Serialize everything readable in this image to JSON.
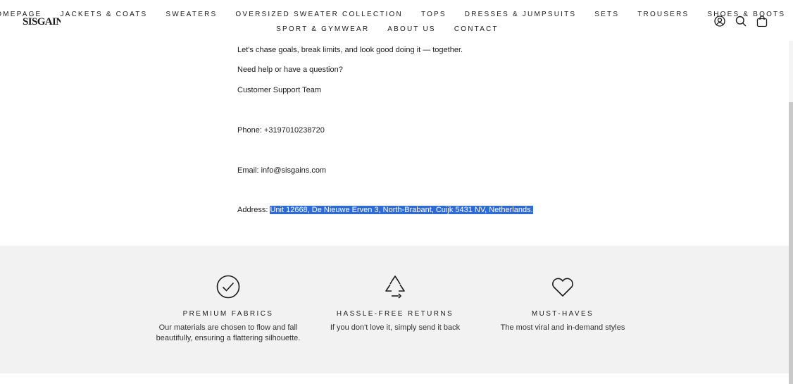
{
  "brand": {
    "logo_text": "SISGAINS"
  },
  "nav": {
    "row1": [
      "Homepage",
      "Jackets & Coats",
      "Sweaters",
      "Oversized Sweater Collection",
      "Tops",
      "Dresses & Jumpsuits",
      "Sets",
      "Trousers",
      "Shoes & Boots"
    ],
    "row2": [
      "Sport & Gymwear",
      "About us",
      "Contact"
    ]
  },
  "header_icons": [
    "account-icon",
    "search-icon",
    "bag-icon"
  ],
  "content": {
    "line1": "Let's chase goals, break limits, and look good doing it — together.",
    "line2": "Need help or have a question?",
    "line3": "Customer Support Team",
    "phone": "Phone: +3197010238720",
    "email": "Email: info@sisgains.com",
    "address_label": "Address: ",
    "address_value": "Unit 12668, De Nieuwe Erven 3, North-Brabant, Cuijk 5431 NV, Netherlands."
  },
  "features": [
    {
      "icon": "checkmark-circle-icon",
      "title": "Premium Fabrics",
      "desc": "Our materials are chosen to flow and fall beautifully, ensuring a flattering silhouette."
    },
    {
      "icon": "recycle-icon",
      "title": "Hassle-Free Returns",
      "desc": "If you don't love it, simply send it back"
    },
    {
      "icon": "heart-icon",
      "title": "Must-Haves",
      "desc": "The most viral and in-demand styles"
    }
  ],
  "colors": {
    "text": "#1c1b1b",
    "band": "#f2f2f2",
    "selection": "#2f6bd6"
  }
}
